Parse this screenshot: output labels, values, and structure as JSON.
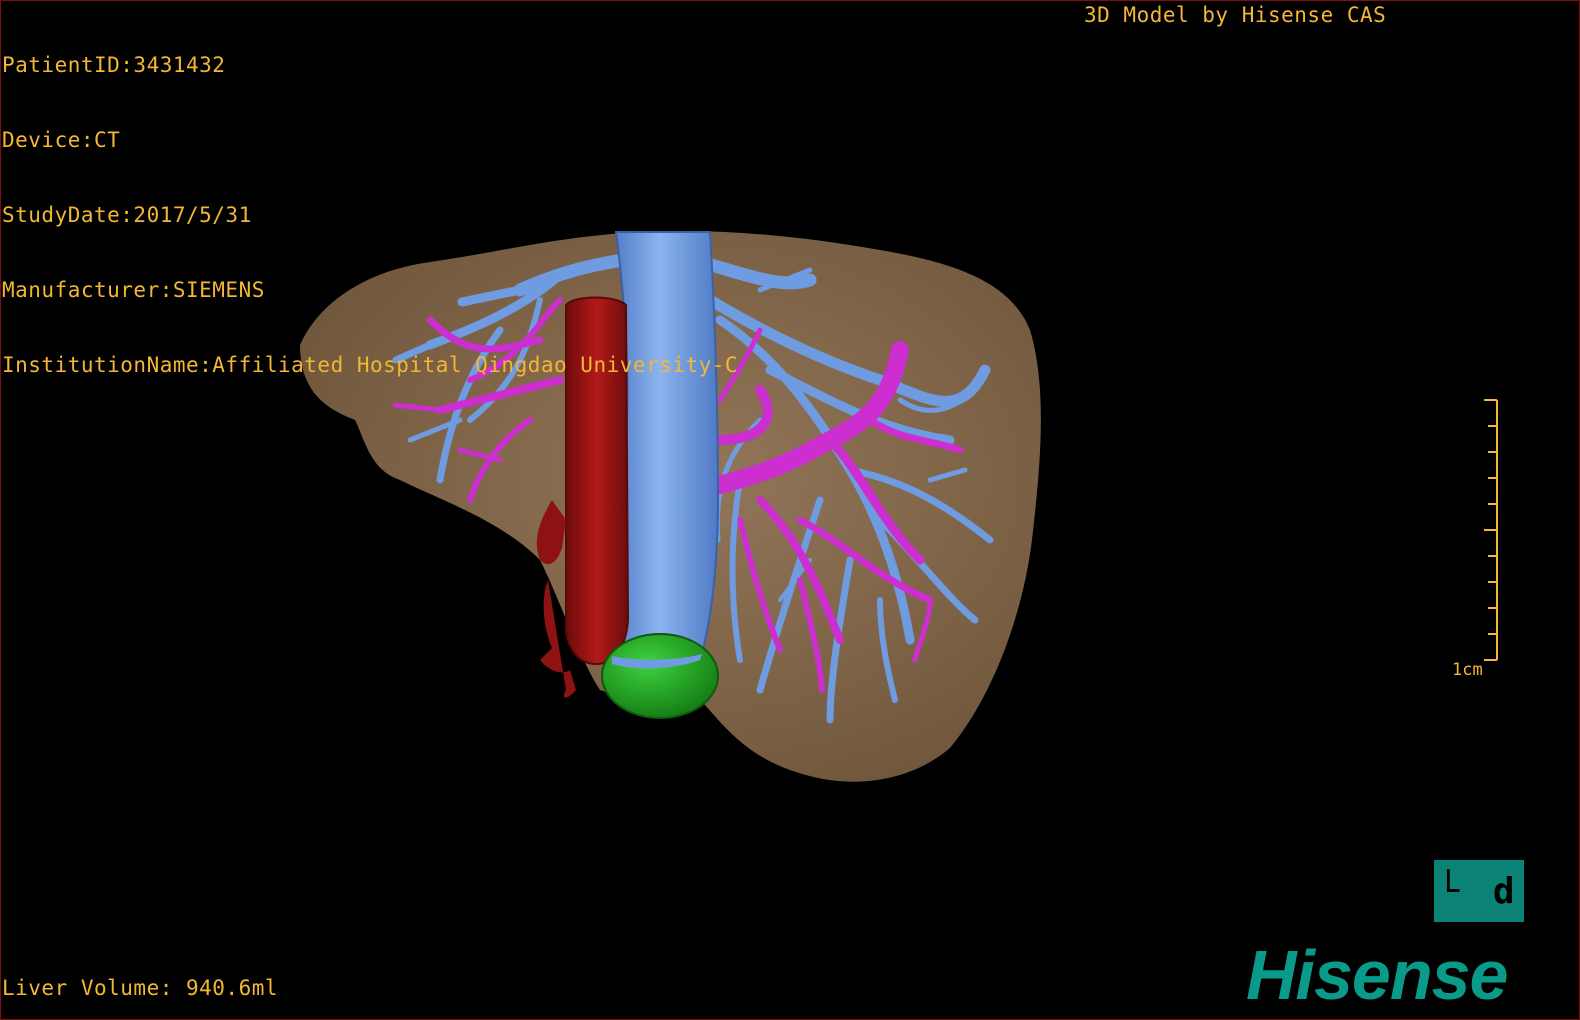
{
  "header": {
    "patient_id": "PatientID:3431432",
    "device": "Device:CT",
    "study_date": "StudyDate:2017/5/31",
    "manufacturer": "Manufacturer:SIEMENS",
    "institution": "InstitutionName:Affiliated Hospital Qingdao University-C",
    "credit": "3D Model by Hisense CAS"
  },
  "footer": {
    "liver_volume": "Liver Volume: 940.6ml"
  },
  "scale_bar": {
    "label": "1cm"
  },
  "orientation": {
    "label": "└ d"
  },
  "brand": {
    "name": "Hisense"
  },
  "colors": {
    "overlay_text": "#f2b733",
    "liver": "#8b6e4e",
    "hepatic_vein": "#6f9be0",
    "portal_vein": "#cc2ed0",
    "ivc_artery": "#9c1414",
    "gallbladder": "#1fa41f",
    "brand": "#0a9a8a"
  }
}
